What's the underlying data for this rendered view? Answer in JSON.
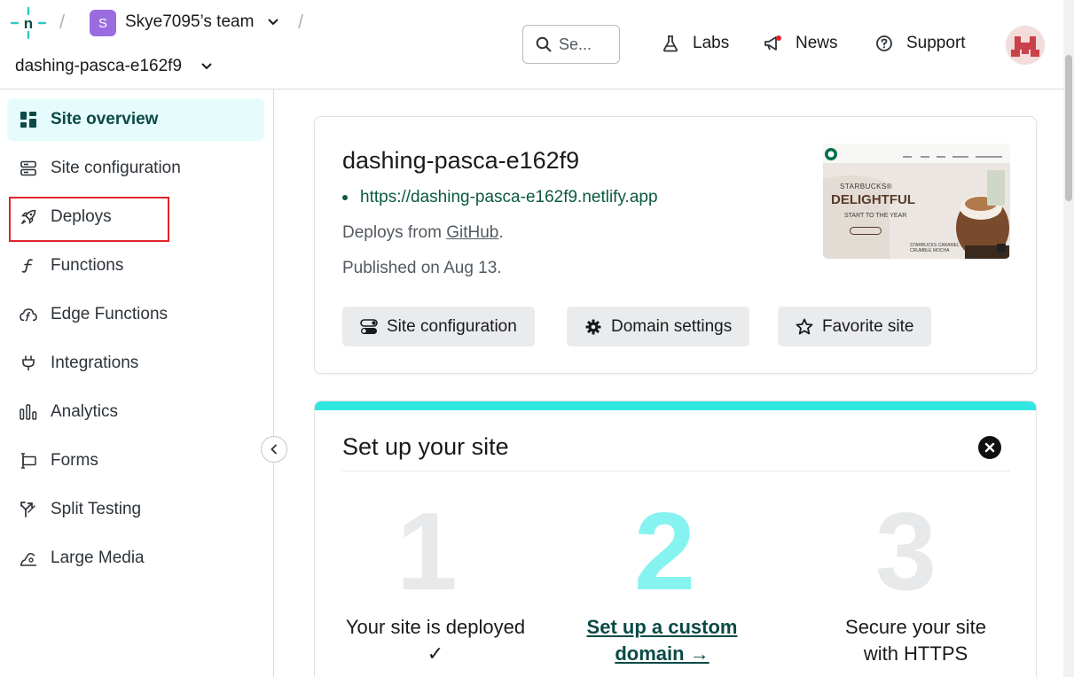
{
  "header": {
    "team_initial": "S",
    "team_name": "Skye7095’s team",
    "site_name": "dashing-pasca-e162f9",
    "search_placeholder": "Se...",
    "nav": {
      "labs": "Labs",
      "news": "News",
      "support": "Support"
    }
  },
  "sidebar": {
    "items": [
      {
        "label": "Site overview",
        "icon": "grid-icon",
        "active": true
      },
      {
        "label": "Site configuration",
        "icon": "server-icon"
      },
      {
        "label": "Deploys",
        "icon": "rocket-icon"
      },
      {
        "label": "Functions",
        "icon": "function-icon"
      },
      {
        "label": "Edge Functions",
        "icon": "edge-function-icon"
      },
      {
        "label": "Integrations",
        "icon": "plug-icon"
      },
      {
        "label": "Analytics",
        "icon": "bar-chart-icon"
      },
      {
        "label": "Forms",
        "icon": "form-icon"
      },
      {
        "label": "Split Testing",
        "icon": "split-icon"
      },
      {
        "label": "Large Media",
        "icon": "media-icon"
      }
    ]
  },
  "site_card": {
    "title": "dashing-pasca-e162f9",
    "url": "https://dashing-pasca-e162f9.netlify.app",
    "deploys_from_prefix": "Deploys from ",
    "deploys_from_link": "GitHub",
    "deploys_from_suffix": ".",
    "published": "Published on Aug 13.",
    "buttons": {
      "site_configuration": "Site configuration",
      "domain_settings": "Domain settings",
      "favorite_site": "Favorite site"
    },
    "thumbnail": {
      "brand": "STARBUCKS®",
      "headline": "DELIGHTFUL",
      "subline": "START TO THE YEAR",
      "product": "STARBUCKS CARAMEL CRUMBLE MOCHA"
    }
  },
  "setup": {
    "title": "Set up your site",
    "steps": [
      {
        "number": "1",
        "label_line1": "Your site is deployed",
        "label_line2": "✓"
      },
      {
        "number": "2",
        "label_line1": "Set up a custom",
        "label_line2": "domain →"
      },
      {
        "number": "3",
        "label_line1": "Secure your site",
        "label_line2": "with HTTPS"
      }
    ]
  },
  "colors": {
    "accent_teal": "#32e6e2",
    "active_bg": "#e6fbfb",
    "highlight_red": "#e0232a",
    "team_badge": "#9a6ce0",
    "url_green": "#0b5a3c"
  }
}
